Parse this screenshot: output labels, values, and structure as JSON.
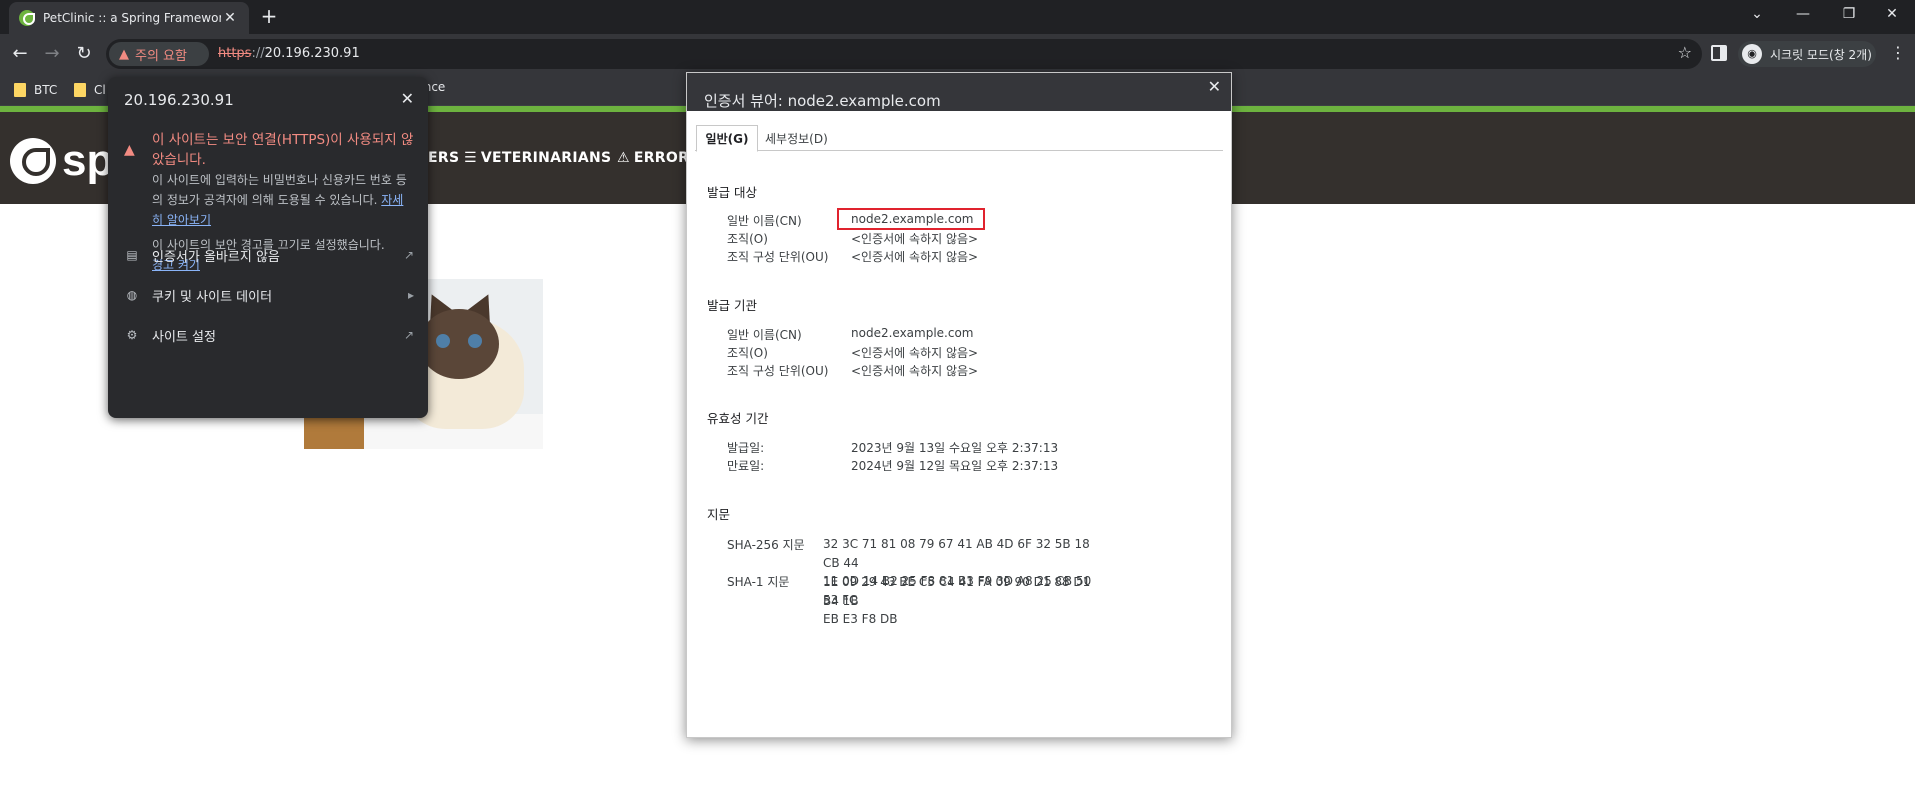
{
  "browser": {
    "tab_title": "PetClinic :: a Spring Framework",
    "tab_close": "✕",
    "new_tab": "+",
    "security_chip": "주의 요함",
    "url_scheme": "https",
    "url_sep": "://",
    "url_host": "20.196.230.91",
    "incognito_label": "시크릿 모드(창 2개)"
  },
  "bookmarks": [
    {
      "label": "BTC"
    },
    {
      "label": "Cl"
    },
    {
      "label": "ience"
    }
  ],
  "petclinic": {
    "logo_text": "sp",
    "nav": [
      {
        "label": "ERS"
      },
      {
        "label": "VETERINARIANS"
      },
      {
        "label": "ERROR"
      }
    ]
  },
  "security_popup": {
    "host": "20.196.230.91",
    "warning_title": "이 사이트는 보안 연결(HTTPS)이 사용되지 않았습니다.",
    "warning_body": "이 사이트에 입력하는 비밀번호나 신용카드 번호 등의 정보가 공격자에 의해 도용될 수 있습니다.",
    "learn_more": "자세히 알아보기",
    "warnings_off_text": "이 사이트의 보안 경고를 끄기로 설정했습니다.",
    "warnings_on_link": "경고 켜기",
    "items": [
      {
        "label": "인증서가 올바르지 않음",
        "icon": "certificate-icon",
        "trail": "external-link-icon"
      },
      {
        "label": "쿠키 및 사이트 데이터",
        "icon": "cookie-icon",
        "trail": "chevron-right-icon"
      },
      {
        "label": "사이트 설정",
        "icon": "gear-icon",
        "trail": "external-link-icon"
      }
    ]
  },
  "cert_viewer": {
    "title": "인증서 뷰어: node2.example.com",
    "tabs": [
      "일반(G)",
      "세부정보(D)"
    ],
    "issued_to": {
      "heading": "발급 대상",
      "cn_label": "일반 이름(CN)",
      "cn": "node2.example.com",
      "o_label": "조직(O)",
      "o": "<인증서에 속하지 않음>",
      "ou_label": "조직 구성 단위(OU)",
      "ou": "<인증서에 속하지 않음>"
    },
    "issued_by": {
      "heading": "발급 기관",
      "cn_label": "일반 이름(CN)",
      "cn": "node2.example.com",
      "o_label": "조직(O)",
      "o": "<인증서에 속하지 않음>",
      "ou_label": "조직 구성 단위(OU)",
      "ou": "<인증서에 속하지 않음>"
    },
    "validity": {
      "heading": "유효성 기간",
      "issued_label": "발급일:",
      "issued": "2023년 9월 13일 수요일 오후 2:37:13",
      "expires_label": "만료일:",
      "expires": "2024년 9월 12일 목요일 오후 2:37:13"
    },
    "fingerprints": {
      "heading": "지문",
      "sha256_label": "SHA-256 지문",
      "sha256_line1": "32 3C 71 81 08 79 67 41 AB 4D 6F 32 5B 18 CB 44",
      "sha256_line2": "1E 09 29 43 BE C5 C4 41 FA 09 90 D1 88 D1 B4 1B",
      "sha1_label": "SHA-1 지문",
      "sha1_line1": "11 0D 14 B2 25 F8 81 B3 F9 3D A8 25 CB 50 53 FC",
      "sha1_line2": "EB E3 F8 DB"
    }
  },
  "colors": {
    "warning_red": "#f28b82",
    "spring_green": "#6db33f",
    "highlight_box": "#e0232e"
  }
}
